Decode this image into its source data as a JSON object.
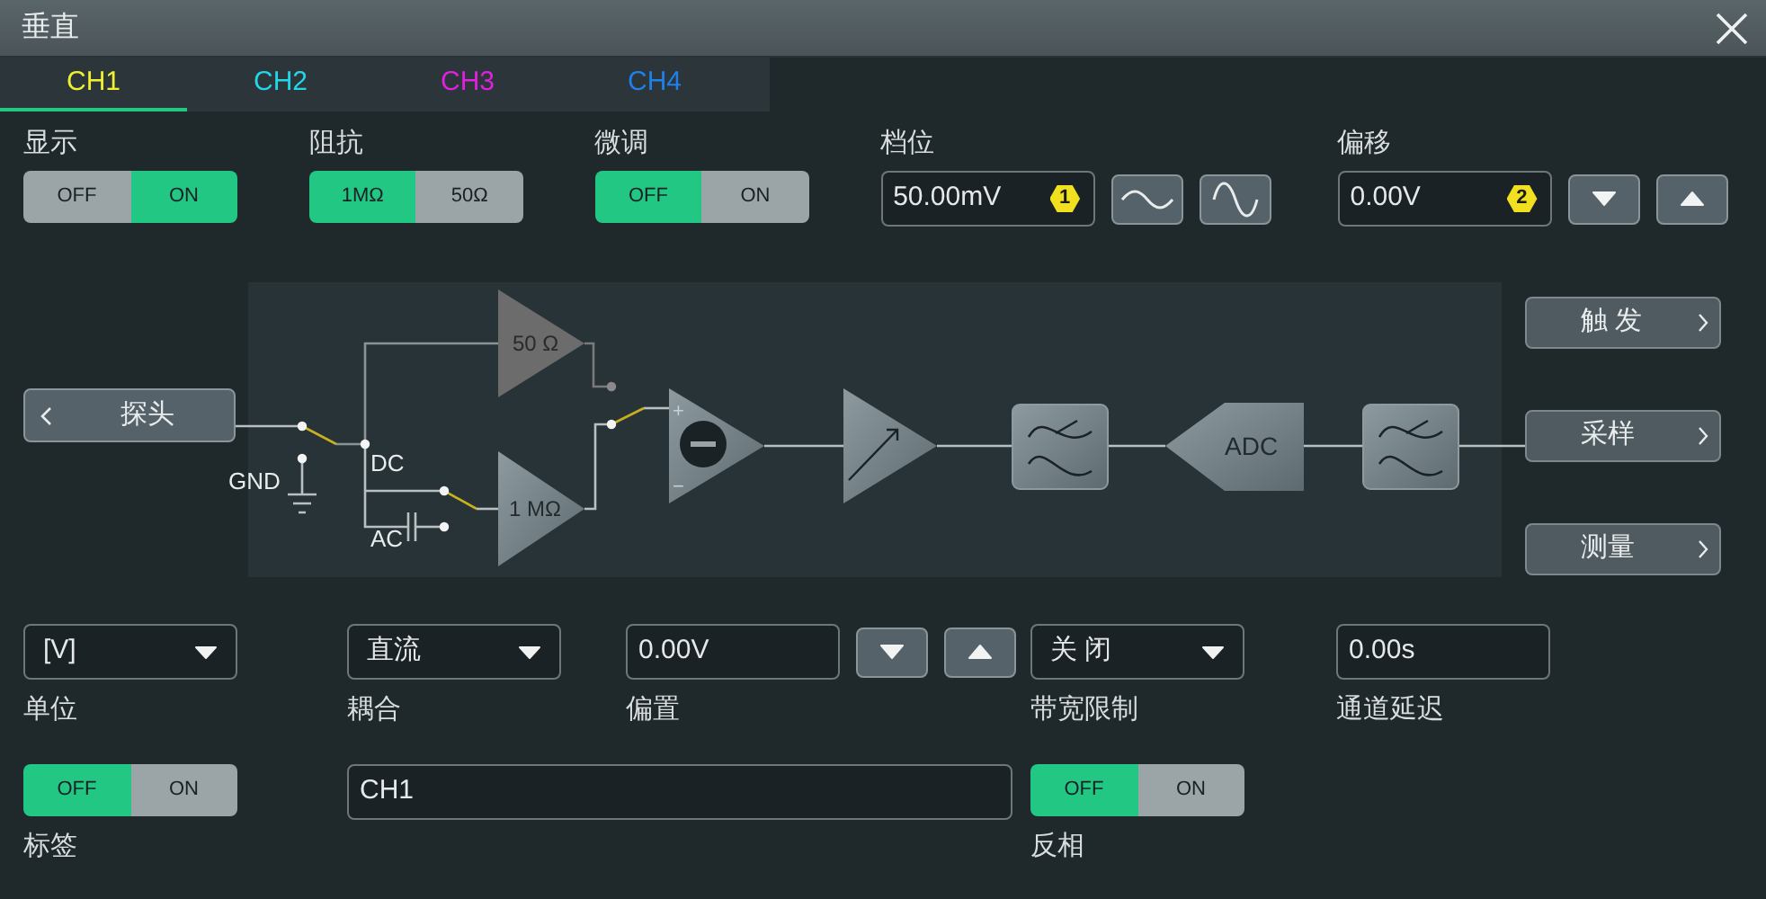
{
  "window": {
    "title": "垂直"
  },
  "tabs": [
    {
      "label": "CH1",
      "selected": true,
      "color": "#f0f032"
    },
    {
      "label": "CH2",
      "selected": false,
      "color": "#22d6e8"
    },
    {
      "label": "CH3",
      "selected": false,
      "color": "#e020e0"
    },
    {
      "label": "CH4",
      "selected": false,
      "color": "#1e80e8"
    }
  ],
  "top_controls": [
    {
      "kind": "toggle",
      "label": "显示",
      "options": [
        {
          "label": "OFF",
          "selected": false
        },
        {
          "label": "ON",
          "selected": true
        }
      ]
    },
    {
      "kind": "toggle",
      "label": "阻抗",
      "options": [
        {
          "label": "1MΩ",
          "selected": true
        },
        {
          "label": "50Ω",
          "selected": false
        }
      ]
    },
    {
      "kind": "toggle",
      "label": "微调",
      "options": [
        {
          "label": "OFF",
          "selected": true
        },
        {
          "label": "ON",
          "selected": false
        }
      ]
    },
    {
      "kind": "field",
      "label": "档位",
      "value": "50.00mV",
      "badge": "1",
      "buttons": [
        {
          "kind": "wave-small"
        },
        {
          "kind": "wave-large"
        }
      ]
    },
    {
      "kind": "field",
      "label": "偏移",
      "value": "0.00V",
      "badge": "2",
      "buttons": [
        {
          "kind": "down"
        },
        {
          "kind": "up"
        }
      ]
    }
  ],
  "diagram": {
    "probe_button": "探头",
    "r50": "50 Ω",
    "r1m": "1 MΩ",
    "gnd": "GND",
    "dc": "DC",
    "ac": "AC",
    "plus": "+",
    "minus": "−",
    "adc": "ADC",
    "side_buttons": [
      "触 发",
      "采样",
      "测量"
    ]
  },
  "bottom_rows": [
    [
      {
        "kind": "dropdown",
        "label": "单位",
        "value": "[V]"
      },
      {
        "kind": "dropdown",
        "label": "耦合",
        "value": "直流"
      },
      {
        "kind": "field",
        "label": "偏置",
        "value": "0.00V",
        "buttons": [
          {
            "kind": "down"
          },
          {
            "kind": "up"
          }
        ]
      },
      {
        "kind": "dropdown",
        "label": "带宽限制",
        "value": "关 闭"
      },
      {
        "kind": "field",
        "label": "通道延迟",
        "value": "0.00s"
      }
    ],
    [
      {
        "kind": "toggle",
        "label": "标签",
        "options": [
          {
            "label": "OFF",
            "selected": true
          },
          {
            "label": "ON",
            "selected": false
          }
        ]
      },
      {
        "kind": "field",
        "value": "CH1"
      },
      {
        "kind": "toggle",
        "label": "反相",
        "options": [
          {
            "label": "OFF",
            "selected": true
          },
          {
            "label": "ON",
            "selected": false
          }
        ]
      }
    ]
  ]
}
